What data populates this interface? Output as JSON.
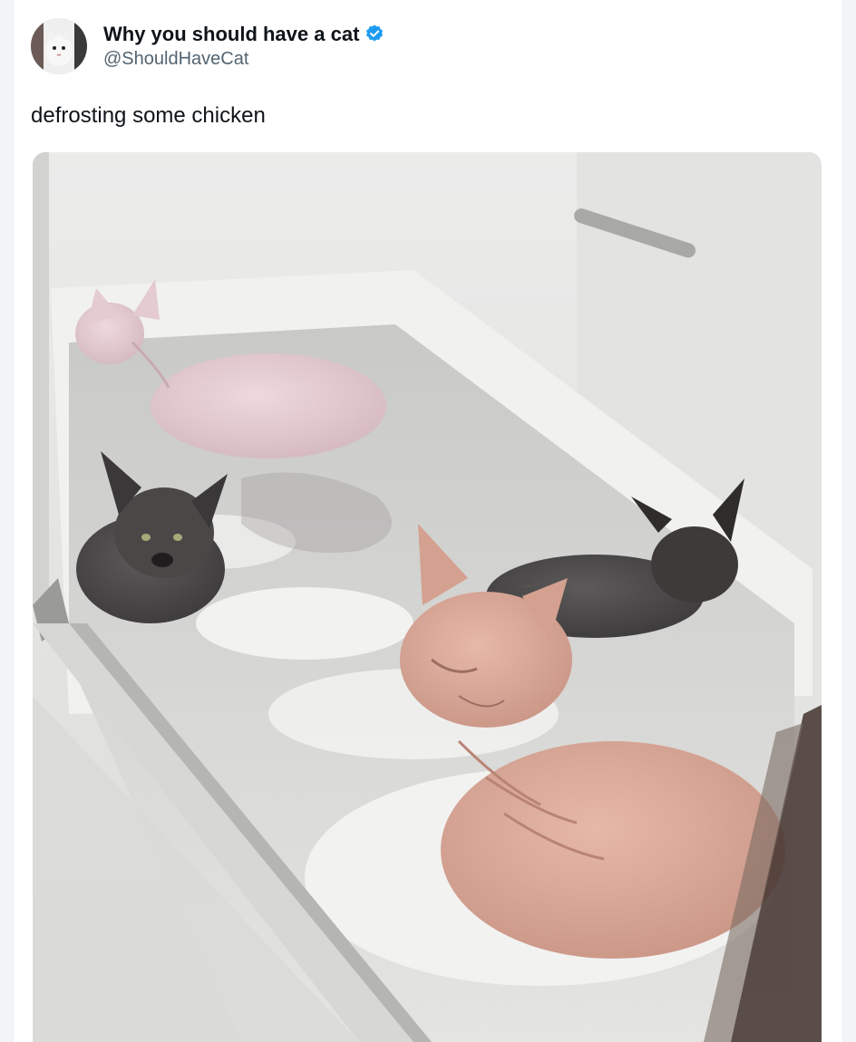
{
  "tweet": {
    "author": {
      "display_name": "Why you should have a cat",
      "handle": "@ShouldHaveCat",
      "verified": true,
      "avatar_icon": "cat-avatar-icon",
      "verified_icon": "verified-badge-icon"
    },
    "text": "defrosting some chicken",
    "media": {
      "kind": "photo",
      "subject": "four hairless sphynx cats in a bathtub with soapy water"
    }
  },
  "colors": {
    "verified_badge": "#1d9bf0",
    "name_text": "#0f1419",
    "handle_text": "#536471"
  }
}
